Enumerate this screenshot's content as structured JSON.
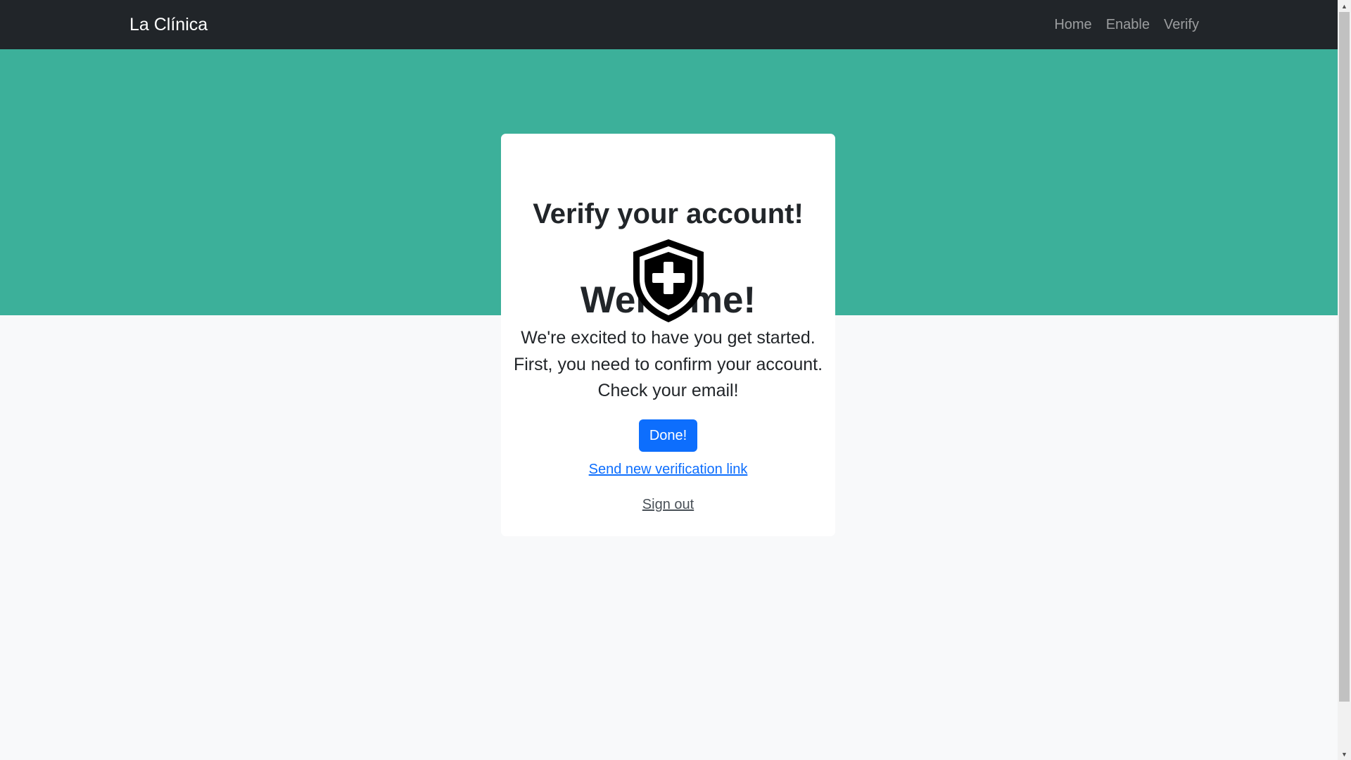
{
  "navbar": {
    "brand": "La Clínica",
    "links": [
      "Home",
      "Enable",
      "Verify"
    ]
  },
  "card": {
    "welcome": "Welcome!",
    "subtitle": "Verify your account!",
    "icon": "shield-medical-icon",
    "message_lines": [
      "We're excited to have you get started.",
      "First, you need to confirm your account.",
      "Check your email!"
    ],
    "done_label": "Done!",
    "resend_label": "Send new verification link",
    "signout_label": "Sign out"
  },
  "colors": {
    "navbar": "#212529",
    "hero": "#3cb09a",
    "page_bg": "#f8f9fa",
    "primary": "#0d6efd"
  }
}
